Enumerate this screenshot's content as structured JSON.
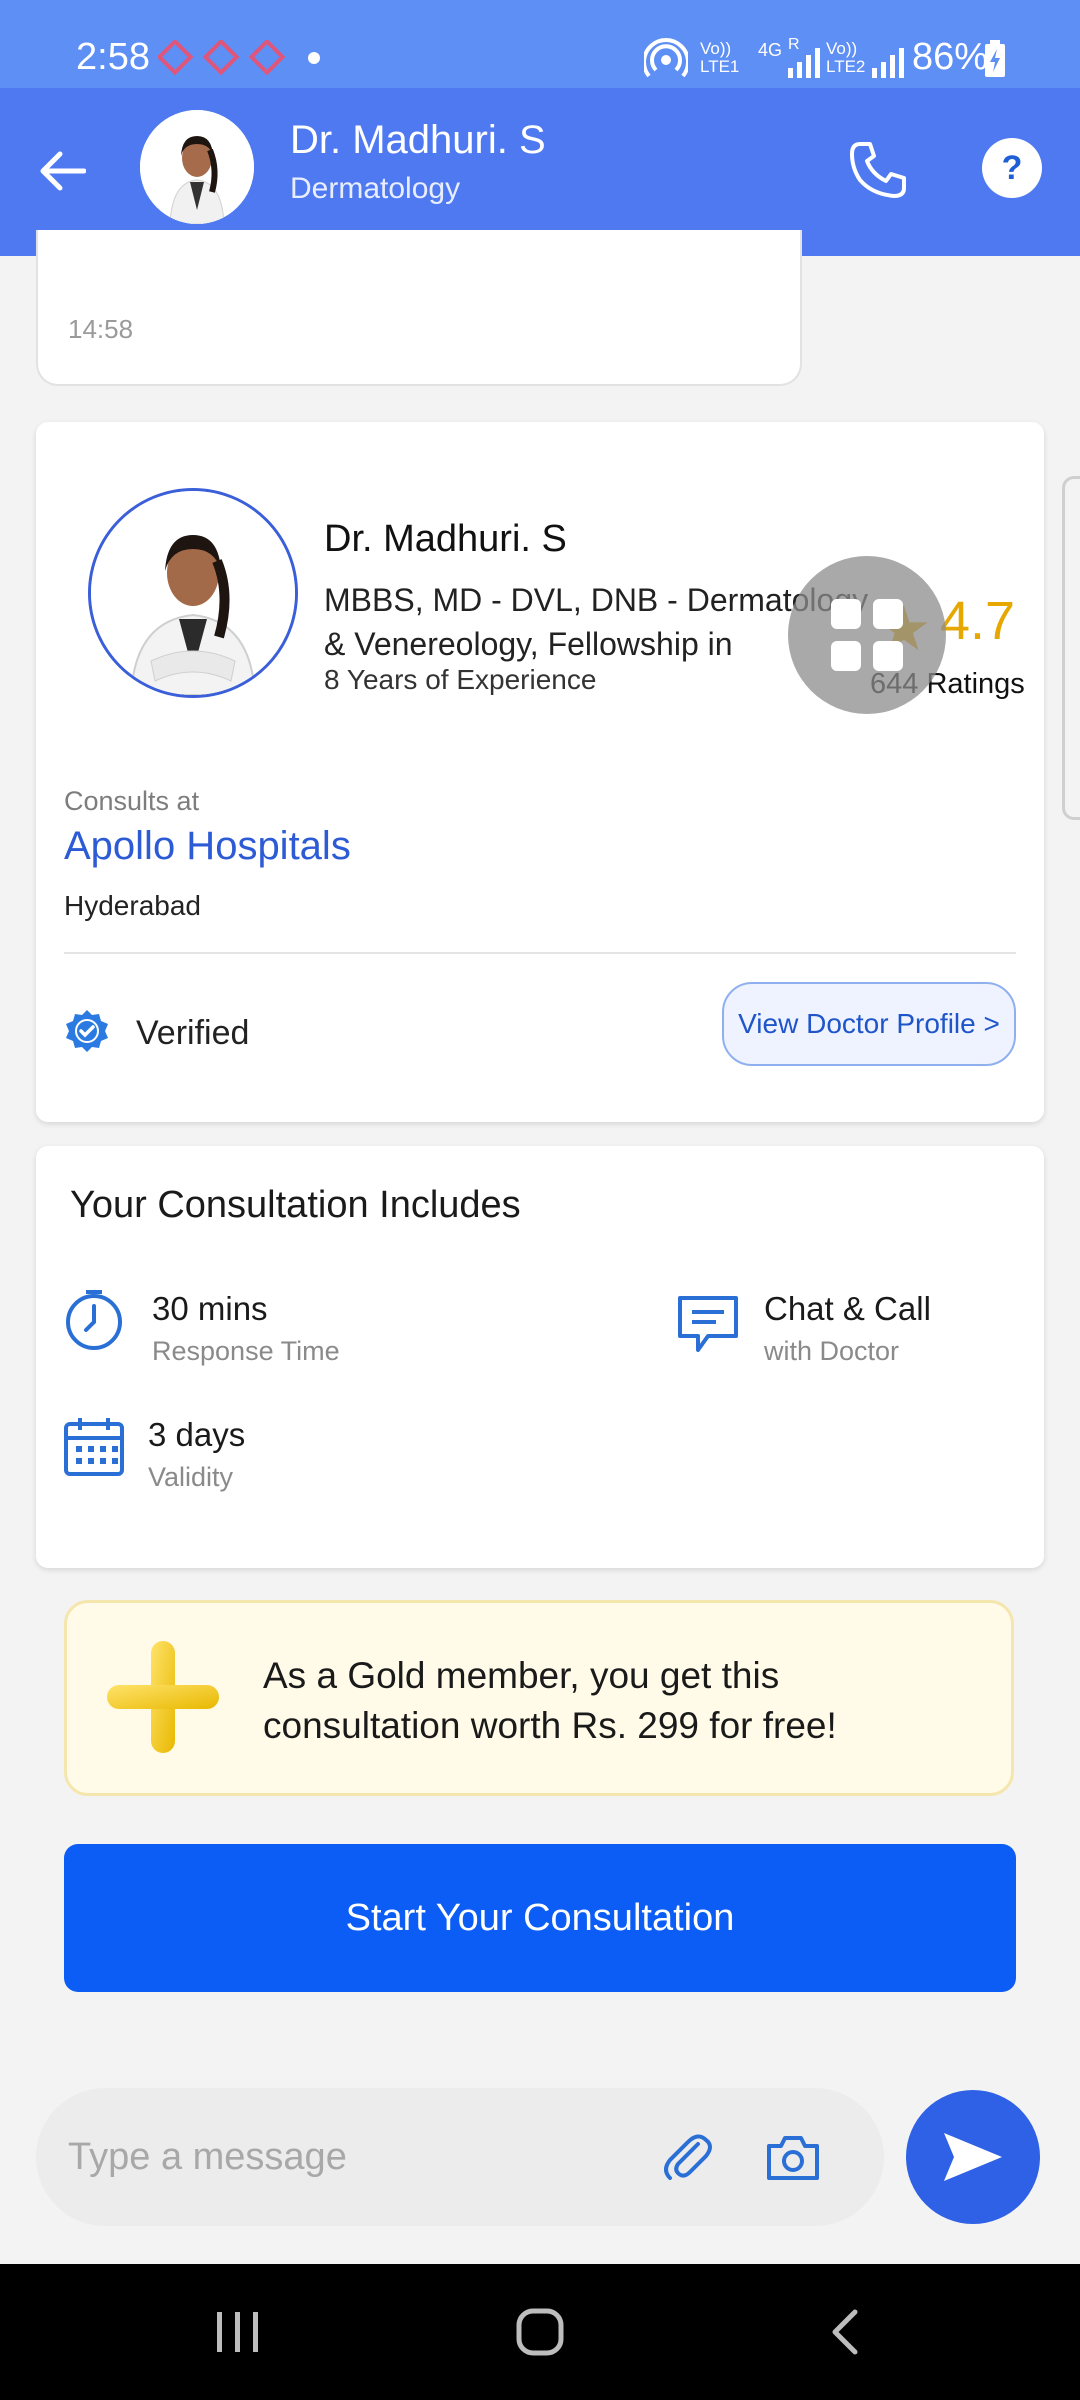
{
  "status_bar": {
    "time": "2:58",
    "network_left": "Vo)) LTE1",
    "network_4g": "4G",
    "network_r": "R",
    "network_right": "Vo)) LTE2",
    "battery": "86%"
  },
  "header": {
    "doctor_name": "Dr. Madhuri. S",
    "specialty": "Dermatology",
    "help_label": "?"
  },
  "bubble": {
    "time": "14:58"
  },
  "doctor_card": {
    "name": "Dr. Madhuri. S",
    "qualifications": "MBBS, MD - DVL, DNB - Dermatology & Venereology, Fellowship in",
    "experience": "8 Years of Experience",
    "rating": "4.7",
    "ratings_count": "644 Ratings",
    "consults_label": "Consults at",
    "hospital": "Apollo Hospitals",
    "city": "Hyderabad",
    "verified": "Verified",
    "view_profile": "View Doctor Profile >"
  },
  "includes": {
    "title": "Your Consultation Includes",
    "items": [
      {
        "main": "30 mins",
        "sub": "Response Time",
        "icon": "clock-icon"
      },
      {
        "main": "Chat & Call",
        "sub": "with Doctor",
        "icon": "chat-icon"
      },
      {
        "main": "3 days",
        "sub": "Validity",
        "icon": "calendar-icon"
      }
    ]
  },
  "gold_banner": {
    "text": "As a Gold member, you get this consultation worth Rs. 299 for free!"
  },
  "start_button": "Start Your Consultation",
  "composer": {
    "placeholder": "Type a message"
  },
  "colors": {
    "header": "#4f79f0",
    "primary_button": "#0c5cf6",
    "rating": "#e6a800",
    "link": "#2d5bd6"
  }
}
